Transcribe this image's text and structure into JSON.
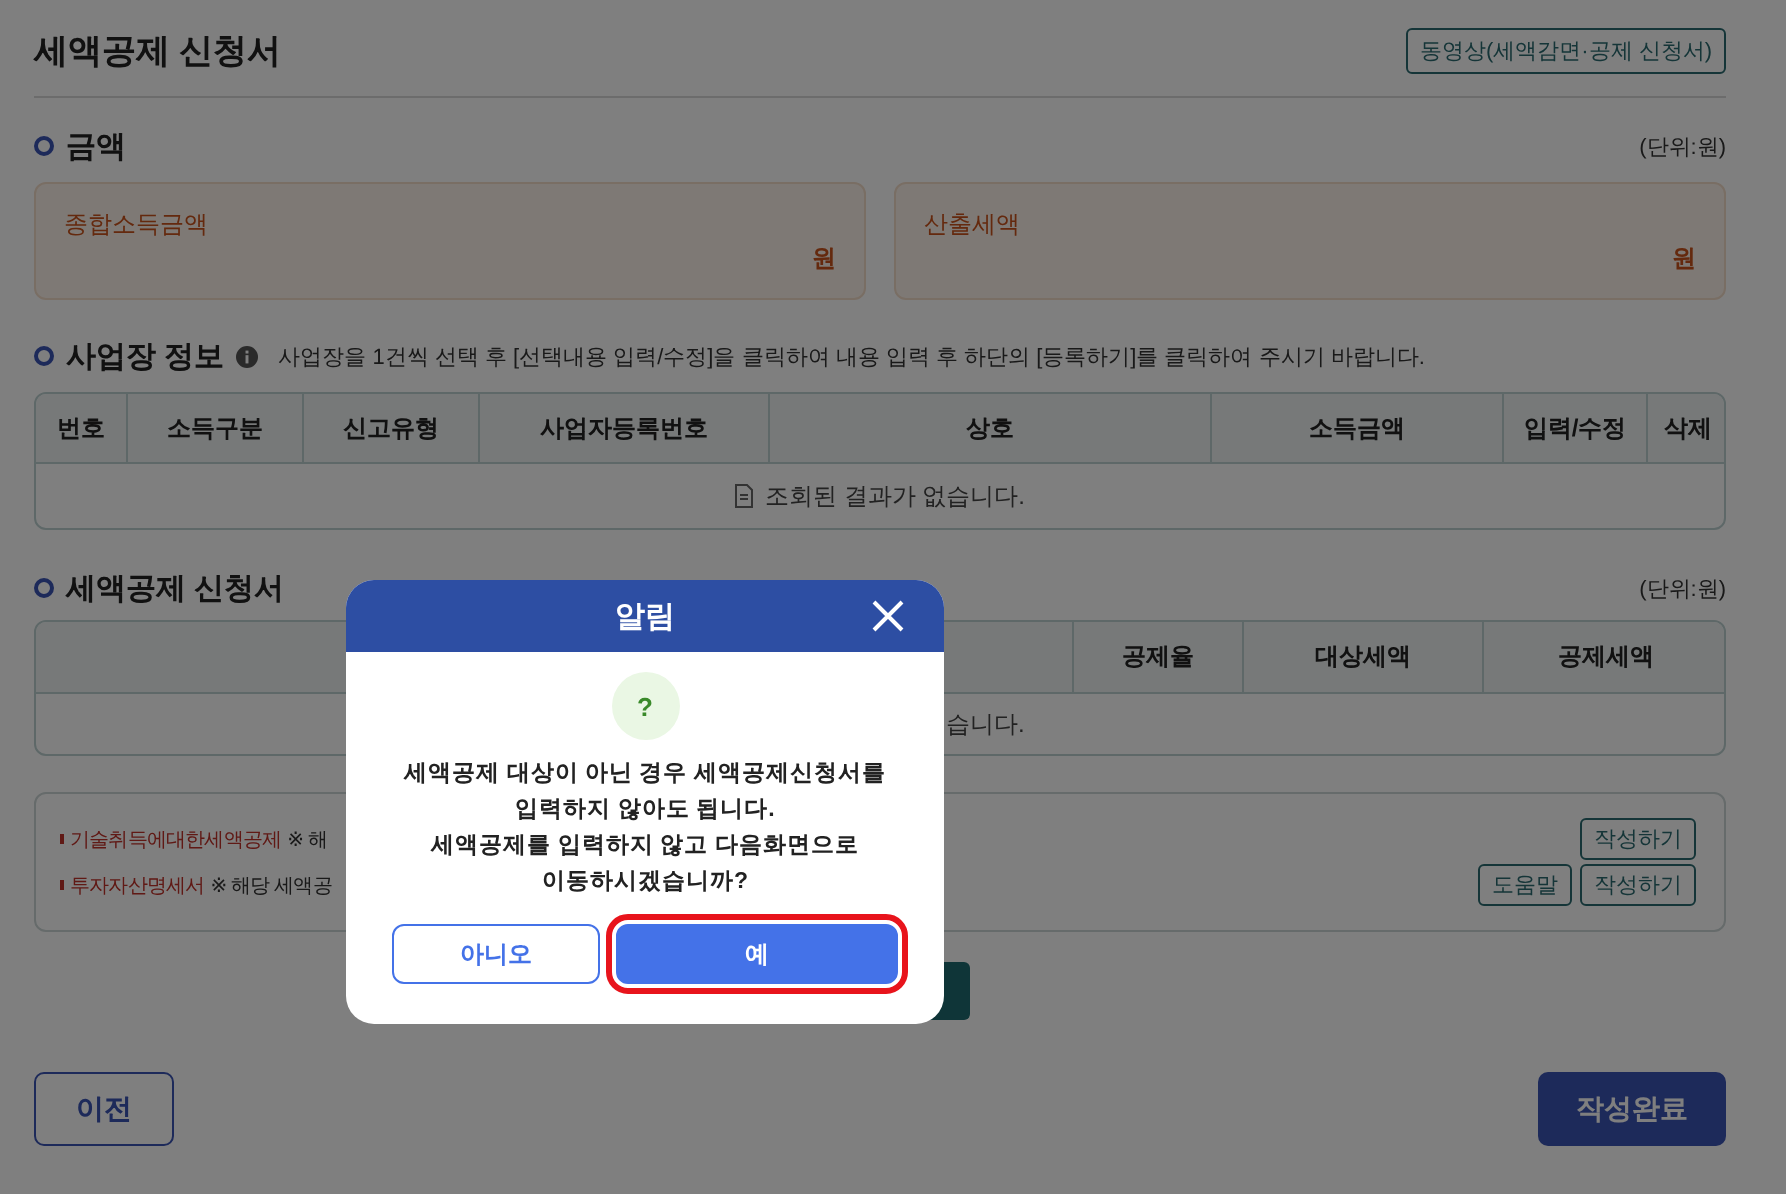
{
  "page": {
    "title": "세액공제 신청서",
    "video_button": "동영상(세액감면·공제 신청서)"
  },
  "amount": {
    "title": "금액",
    "unit": "(단위:원)",
    "fields": [
      {
        "label": "종합소득금액",
        "suffix": "원"
      },
      {
        "label": "산출세액",
        "suffix": "원"
      }
    ]
  },
  "business": {
    "title": "사업장 정보",
    "hint": "사업장을 1건씩 선택 후 [선택내용 입력/수정]을 클릭하여 내용 입력 후 하단의 [등록하기]를 클릭하여 주시기 바랍니다.",
    "columns": [
      "번호",
      "소득구분",
      "신고유형",
      "사업자등록번호",
      "상호",
      "소득금액",
      "입력/수정",
      "삭제"
    ],
    "empty": "조회된 결과가 없습니다."
  },
  "deduction": {
    "title": "세액공제 신청서",
    "unit": "(단위:원)",
    "columns": [
      "공제율",
      "대상세액",
      "공제세액"
    ],
    "empty": "습니다.",
    "notes": [
      {
        "name": "기술취득에대한세액공제",
        "text": "※ 해",
        "buttons": [
          "작성하기"
        ]
      },
      {
        "name": "투자자산명세서",
        "text": "※ 해당 세액공",
        "buttons": [
          "도움말",
          "작성하기"
        ]
      }
    ]
  },
  "footer": {
    "prev": "이전",
    "done": "작성완료"
  },
  "dialog": {
    "title": "알림",
    "icon": "?",
    "message": [
      "세액공제 대상이 아닌 경우 세액공제신청서를",
      "입력하지 않아도 됩니다.",
      "세액공제를 입력하지 않고 다음화면으로",
      "이동하시겠습니까?"
    ],
    "buttons": [
      {
        "label": "아니오",
        "kind": "secondary",
        "highlighted": false
      },
      {
        "label": "예",
        "kind": "primary",
        "highlighted": true
      }
    ]
  }
}
